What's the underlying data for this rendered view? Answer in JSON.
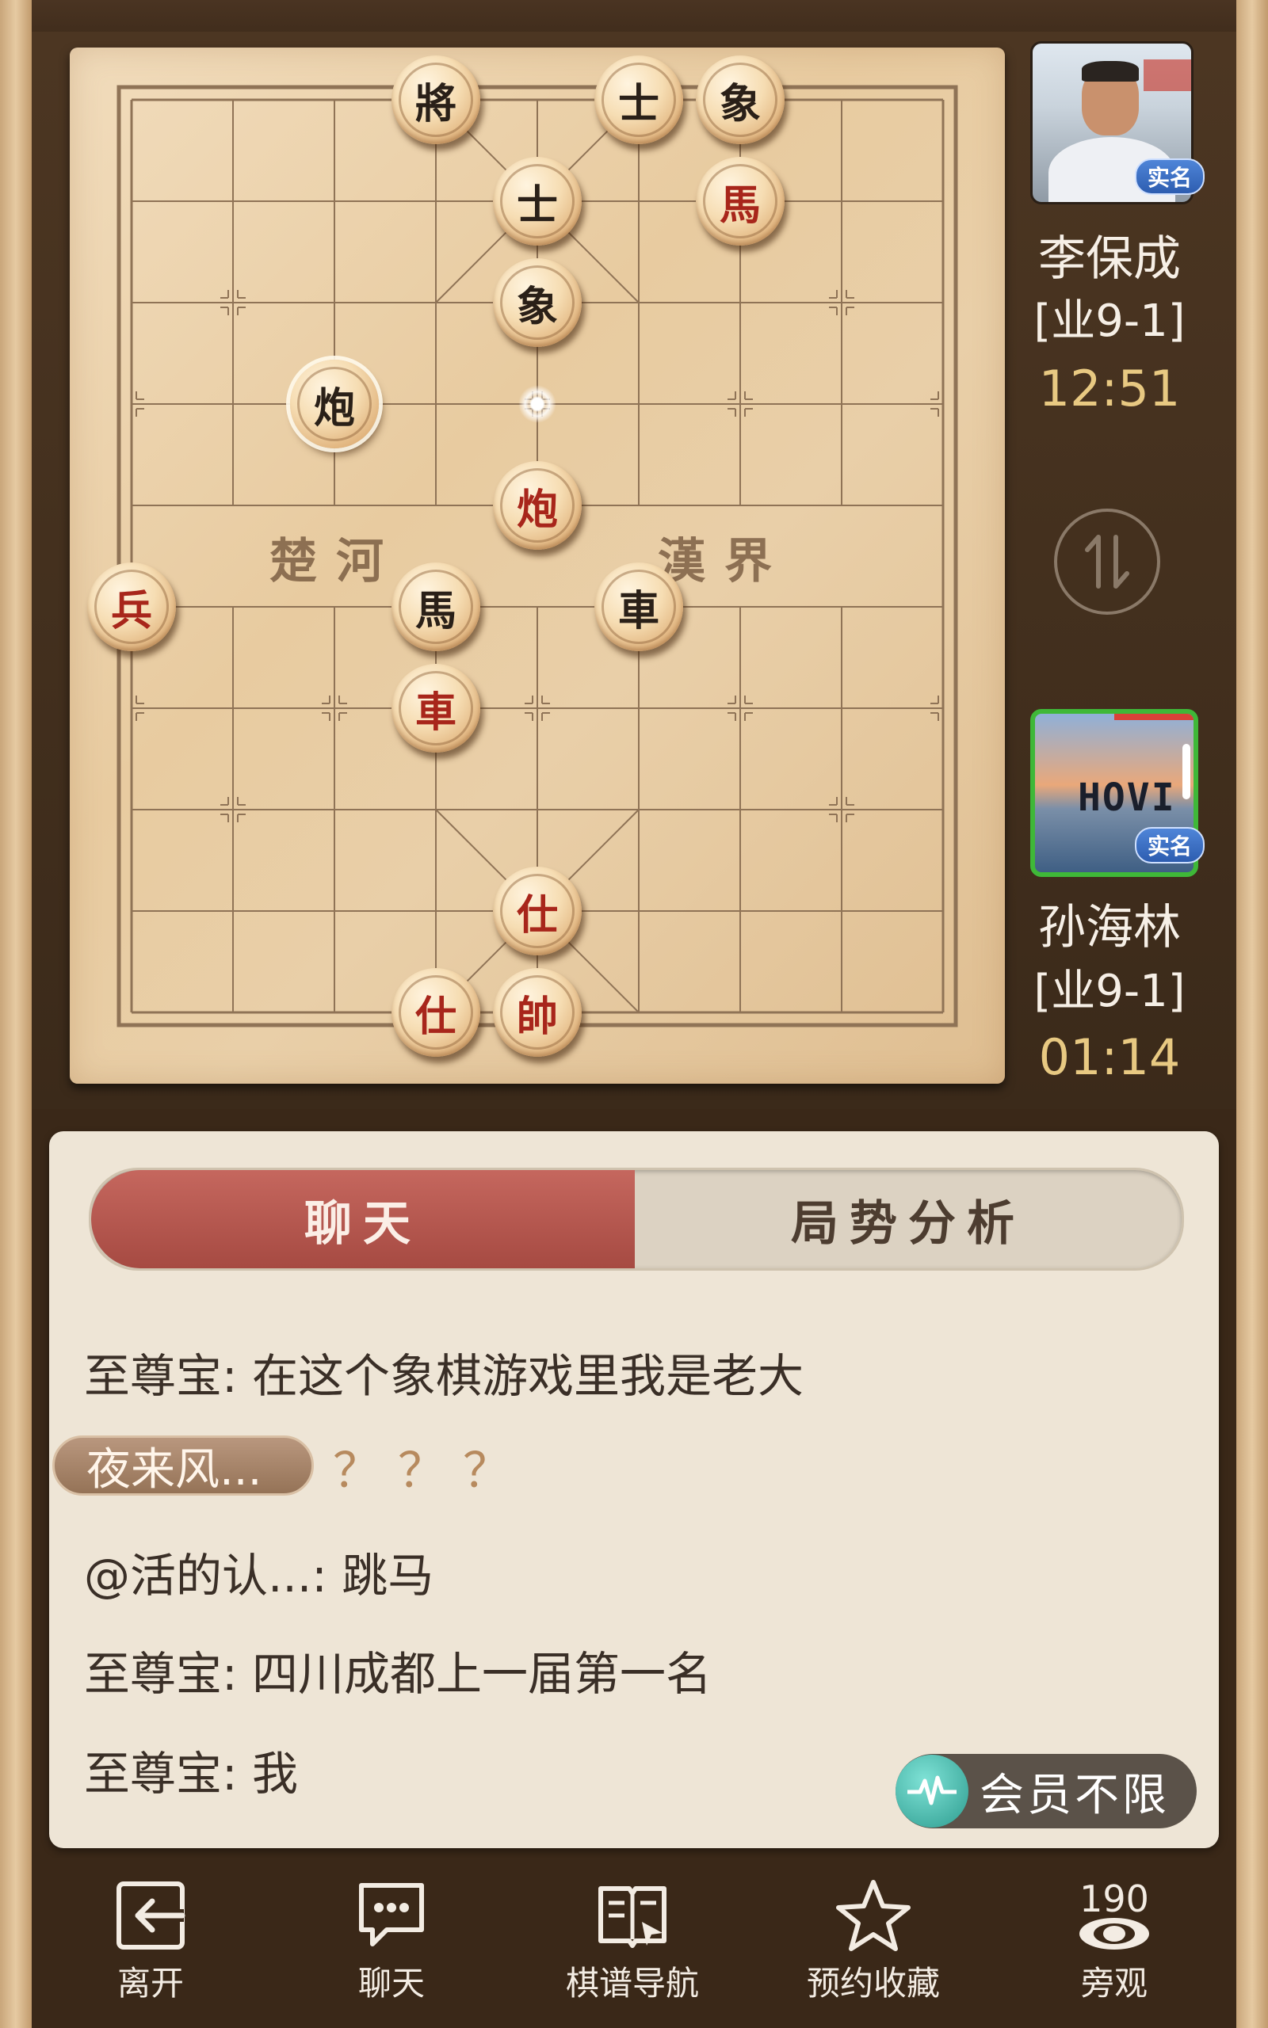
{
  "board": {
    "river_left": "楚河",
    "river_right": "漢界",
    "pieces": [
      {
        "char": "將",
        "side": "black",
        "file": 3,
        "rank": 0
      },
      {
        "char": "士",
        "side": "black",
        "file": 5,
        "rank": 0
      },
      {
        "char": "象",
        "side": "black",
        "file": 6,
        "rank": 0
      },
      {
        "char": "士",
        "side": "black",
        "file": 4,
        "rank": 1
      },
      {
        "char": "馬",
        "side": "red",
        "file": 6,
        "rank": 1
      },
      {
        "char": "象",
        "side": "black",
        "file": 4,
        "rank": 2
      },
      {
        "char": "炮",
        "side": "black",
        "file": 2,
        "rank": 3,
        "highlight": true
      },
      {
        "char": "炮",
        "side": "red",
        "file": 4,
        "rank": 4
      },
      {
        "char": "兵",
        "side": "red",
        "file": 0,
        "rank": 5
      },
      {
        "char": "馬",
        "side": "black",
        "file": 3,
        "rank": 5
      },
      {
        "char": "車",
        "side": "black",
        "file": 5,
        "rank": 5
      },
      {
        "char": "車",
        "side": "red",
        "file": 3,
        "rank": 6
      },
      {
        "char": "仕",
        "side": "red",
        "file": 4,
        "rank": 8
      },
      {
        "char": "仕",
        "side": "red",
        "file": 3,
        "rank": 9
      },
      {
        "char": "帥",
        "side": "red",
        "file": 4,
        "rank": 9
      }
    ],
    "last_move_marker": {
      "file": 4,
      "rank": 3
    }
  },
  "top_player": {
    "name": "李保成",
    "rank": "[业9-1]",
    "time": "12:51",
    "badge": "实名"
  },
  "bottom_player": {
    "name": "孙海林",
    "rank": "[业9-1]",
    "time": "01:14",
    "badge": "实名",
    "avatar_text": "HOVI"
  },
  "tabs": {
    "chat": "聊天",
    "analysis": "局势分析"
  },
  "messages": [
    "至尊宝: 在这个象棋游戏里我是老大",
    "@活的认...: 跳马",
    "至尊宝: 四川成都上一届第一名",
    "至尊宝: 我"
  ],
  "highlight_message": {
    "name": "夜来风...",
    "text": "？？？"
  },
  "vip_label": "会员不限",
  "bottom_nav": {
    "leave": "离开",
    "chat": "聊天",
    "manual": "棋谱导航",
    "favorite": "预约收藏",
    "watch": "旁观",
    "watchers": "190"
  },
  "colors": {
    "red_piece": "#a8261b",
    "black_piece": "#2a2018",
    "time": "#e8c982",
    "chat_tab": "#b2544b"
  }
}
